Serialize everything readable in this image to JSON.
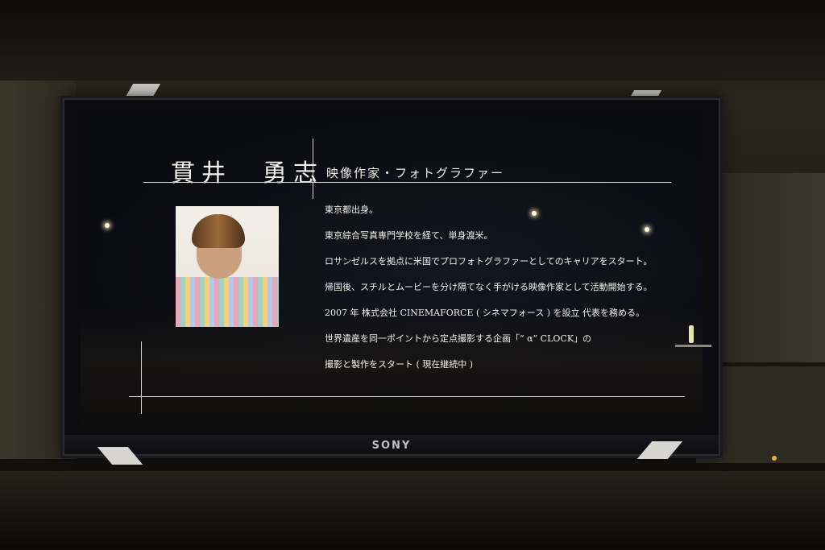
{
  "screen": {
    "name": "貫井　勇志",
    "role": "映像作家・フォトグラファー",
    "bio_lines": [
      "東京都出身。",
      "東京綜合写真専門学校を経て、単身渡米。",
      "ロサンゼルスを拠点に米国でプロフォトグラファーとしてのキャリアをスタート。",
      "帰国後、スチルとムービーを分け隔てなく手がける映像作家として活動開始する。",
      "2007 年 株式会社 CINEMAFORCE ( シネマフォース ) を設立 代表を務める。",
      "世界遺産を同一ポイントから定点撮影する企画「” α” CLOCK」の",
      "撮影と製作をスタート ( 現在継続中 )"
    ]
  },
  "tv": {
    "brand": "SONY"
  }
}
